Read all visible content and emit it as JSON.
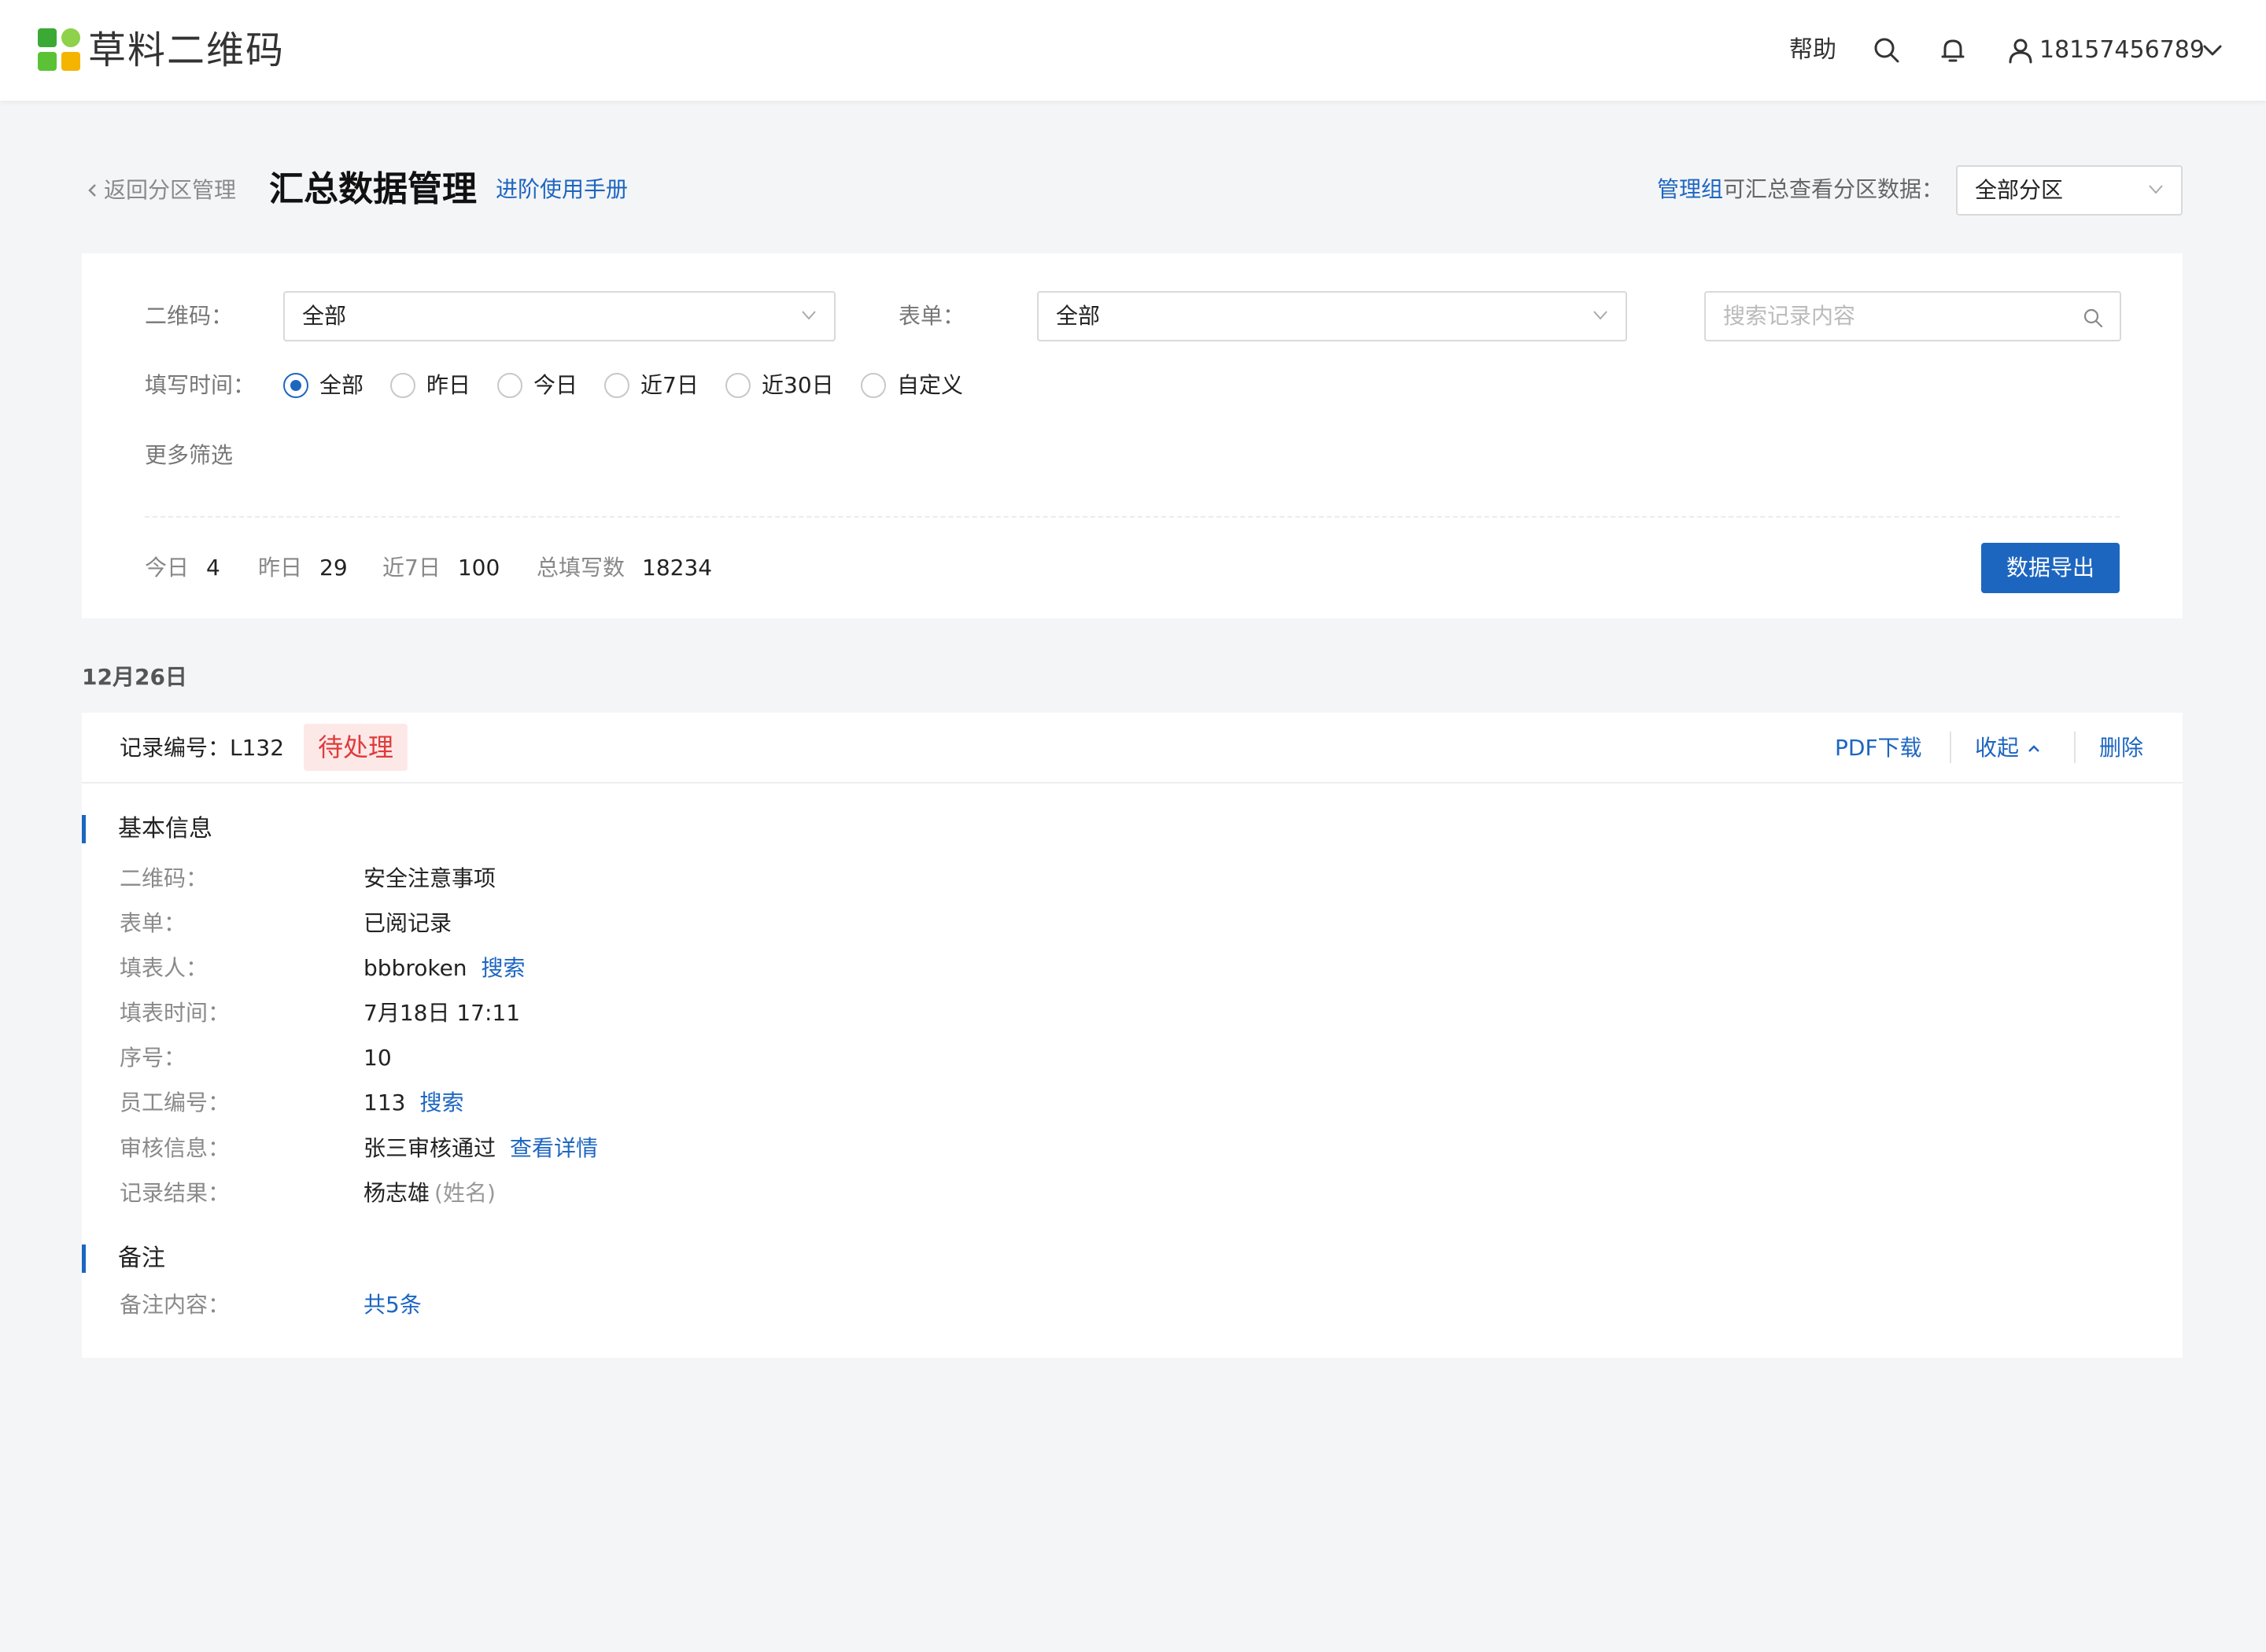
{
  "header": {
    "brand": "草料二维码",
    "help": "帮助",
    "user_phone": "18157456789",
    "brand_colors": [
      "#3aaa35",
      "#5bc236",
      "#8ed14b",
      "#f5b400"
    ]
  },
  "page": {
    "back_label": "返回分区管理",
    "title": "汇总数据管理",
    "manual_link": "进阶使用手册",
    "manager_group": "管理组",
    "manager_text": "可汇总查看分区数据：",
    "partition_value": "全部分区"
  },
  "filters": {
    "qrcode_label": "二维码：",
    "qrcode_value": "全部",
    "form_label": "表单：",
    "form_value": "全部",
    "search_placeholder": "搜索记录内容",
    "time_label": "填写时间：",
    "time_options": [
      "全部",
      "昨日",
      "今日",
      "近7日",
      "近30日",
      "自定义"
    ],
    "time_selected": "全部",
    "more_filters": "更多筛选"
  },
  "stats": {
    "today_label": "今日",
    "today_value": "4",
    "yesterday_label": "昨日",
    "yesterday_value": "29",
    "week_label": "近7日",
    "week_value": "100",
    "total_label": "总填写数",
    "total_value": "18234",
    "export_label": "数据导出"
  },
  "group_date": "12月26日",
  "record": {
    "number_label": "记录编号：L132",
    "status": "待处理",
    "actions": {
      "pdf": "PDF下载",
      "collapse": "收起",
      "delete": "删除"
    },
    "basic_title": "基本信息",
    "fields": {
      "qrcode_label": "二维码：",
      "qrcode_value": "安全注意事项",
      "form_label": "表单：",
      "form_value": "已阅记录",
      "filler_label": "填表人：",
      "filler_value": "bbbroken",
      "filler_link": "搜索",
      "time_label": "填表时间：",
      "time_value": "7月18日 17:11",
      "seq_label": "序号：",
      "seq_value": "10",
      "emp_label": "员工编号：",
      "emp_value": "113",
      "emp_link": "搜索",
      "audit_label": "审核信息：",
      "audit_value": "张三审核通过",
      "audit_link": "查看详情",
      "result_label": "记录结果：",
      "result_value": "杨志雄",
      "result_note": "(姓名)"
    },
    "remark_title": "备注",
    "remark_label": "备注内容：",
    "remark_link": "共5条"
  }
}
